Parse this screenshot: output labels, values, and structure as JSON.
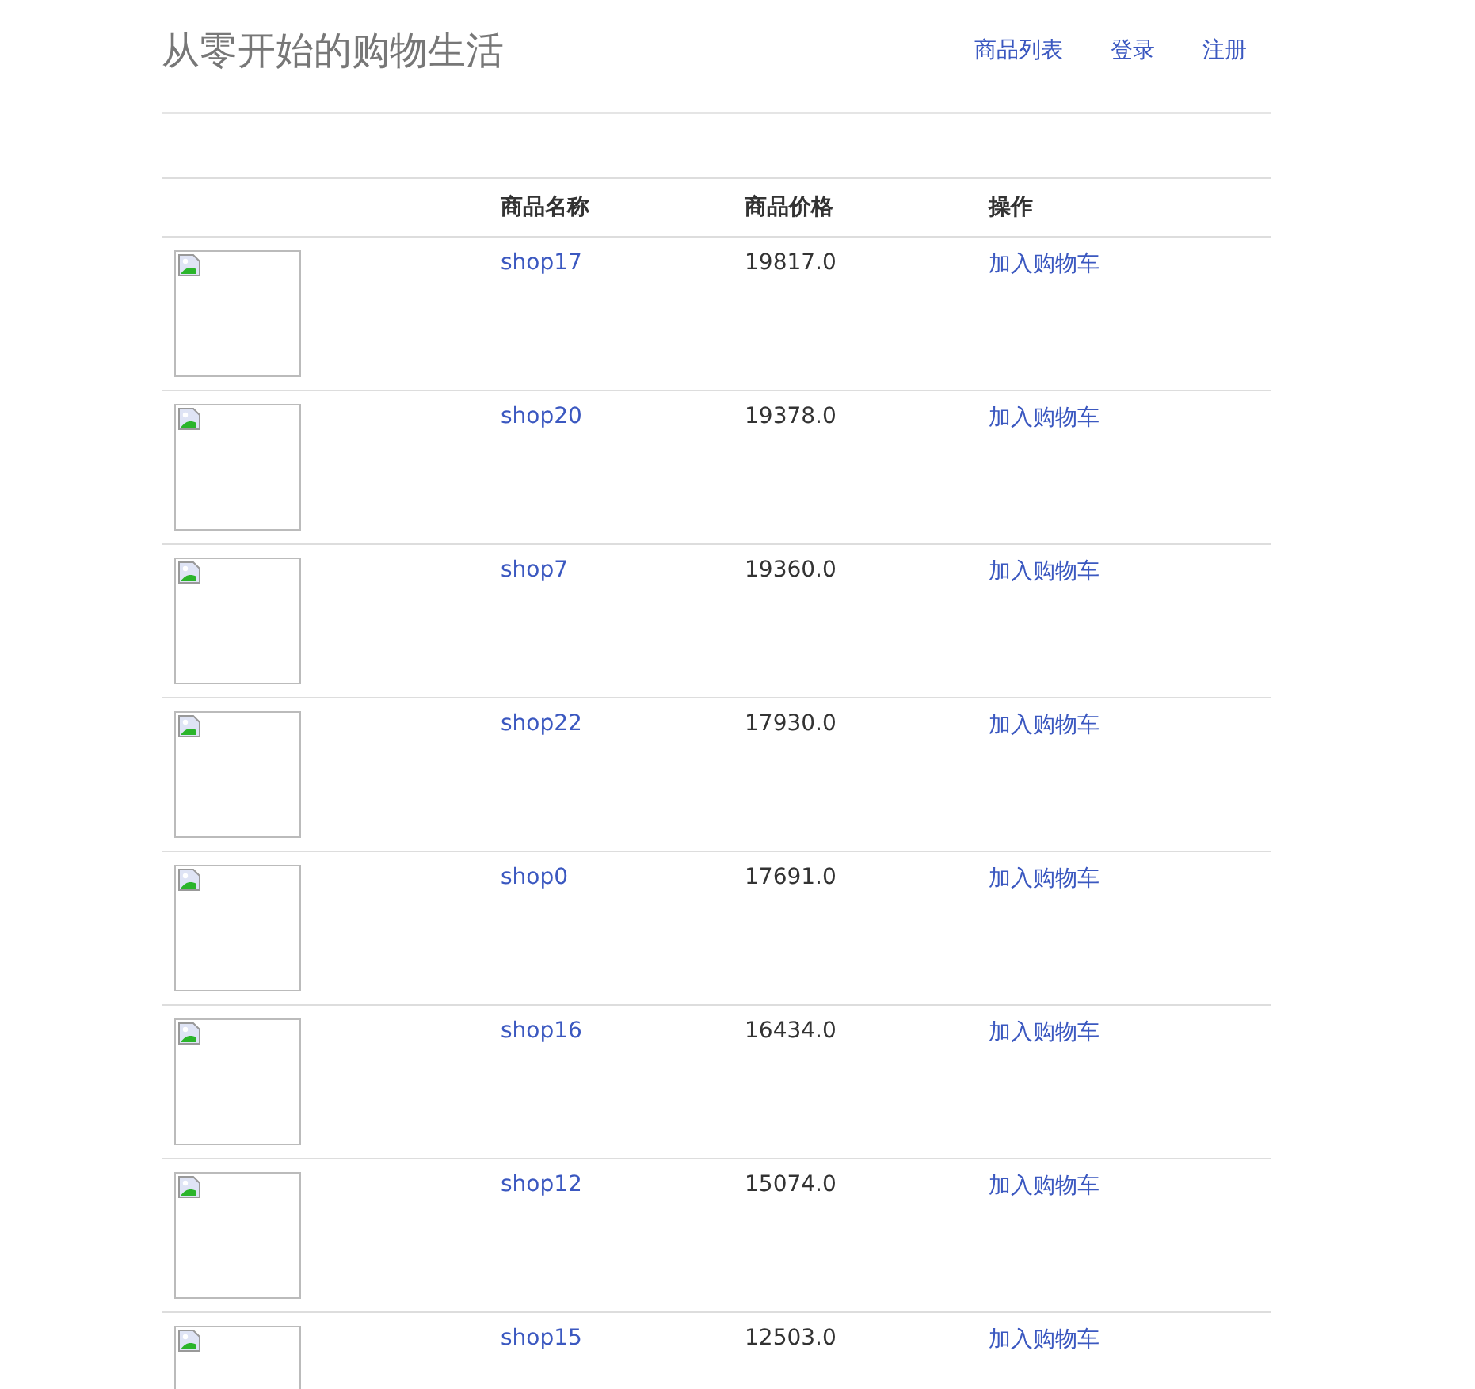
{
  "header": {
    "title": "从零开始的购物生活",
    "nav": [
      "商品列表",
      "登录",
      "注册"
    ]
  },
  "table": {
    "columns": [
      "商品名称",
      "商品价格",
      "操作"
    ],
    "rows": [
      {
        "name": "shop17",
        "price": "19817.0",
        "action": "加入购物车"
      },
      {
        "name": "shop20",
        "price": "19378.0",
        "action": "加入购物车"
      },
      {
        "name": "shop7",
        "price": "19360.0",
        "action": "加入购物车"
      },
      {
        "name": "shop22",
        "price": "17930.0",
        "action": "加入购物车"
      },
      {
        "name": "shop0",
        "price": "17691.0",
        "action": "加入购物车"
      },
      {
        "name": "shop16",
        "price": "16434.0",
        "action": "加入购物车"
      },
      {
        "name": "shop12",
        "price": "15074.0",
        "action": "加入购物车"
      },
      {
        "name": "shop15",
        "price": "12503.0",
        "action": "加入购物车"
      }
    ]
  }
}
